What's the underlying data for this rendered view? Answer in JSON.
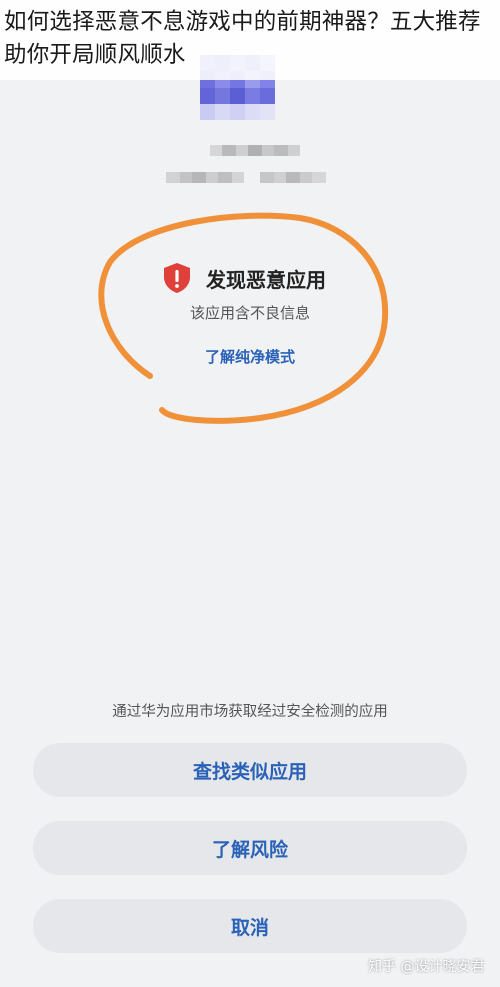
{
  "article_title": "如何选择恶意不息游戏中的前期神器？五大推荐助你开局顺风顺水",
  "warning": {
    "title": "发现恶意应用",
    "description": "该应用含不良信息",
    "link": "了解纯净模式",
    "icon": "shield-warning-icon",
    "icon_color": "#e0403a",
    "highlight_color": "#f0913a"
  },
  "notice": "通过华为应用市场获取经过安全检测的应用",
  "buttons": {
    "find_similar": "查找类似应用",
    "learn_risk": "了解风险",
    "cancel": "取消"
  },
  "watermark": "知乎 @设计晓安君",
  "colors": {
    "accent": "#2a62b8",
    "background": "#f1f2f4",
    "button_bg": "#e6e7ea"
  }
}
